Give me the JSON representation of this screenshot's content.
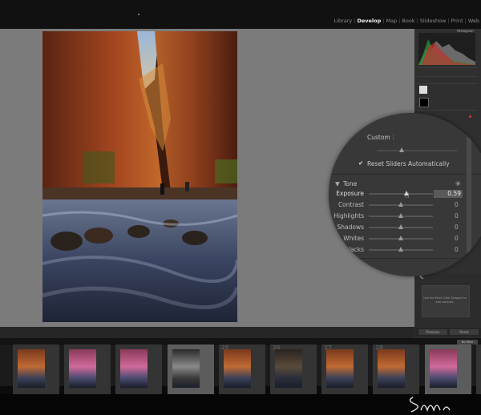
{
  "modules": {
    "items": [
      {
        "label": "Library",
        "active": false
      },
      {
        "label": "Develop",
        "active": true
      },
      {
        "label": "Map",
        "active": false
      },
      {
        "label": "Book",
        "active": false
      },
      {
        "label": "Slideshow",
        "active": false
      },
      {
        "label": "Print",
        "active": false
      },
      {
        "label": "Web",
        "active": false
      }
    ]
  },
  "right_panel": {
    "histogram_label": "Histogram",
    "dropper_hint": "Use the Point Color Dropper to add samples.",
    "previous_label": "Previous",
    "reset_label": "Reset"
  },
  "zoom_panel": {
    "profile_value": "Custom",
    "reset_sliders_label": "Reset Sliders Automatically",
    "tone_header": "Tone",
    "sliders": [
      {
        "label": "Exposure",
        "value": "0.59",
        "level": 0.57
      },
      {
        "label": "Contrast",
        "value": "0",
        "level": 0.5
      },
      {
        "label": "Highlights",
        "value": "0",
        "level": 0.5
      },
      {
        "label": "Shadows",
        "value": "0",
        "level": 0.5
      },
      {
        "label": "Whites",
        "value": "0",
        "level": 0.5
      },
      {
        "label": "Blacks",
        "value": "0",
        "level": 0.5
      }
    ]
  },
  "filmstrip": {
    "filter_label": "No Filter",
    "frames": [
      {
        "num": "",
        "selected": false,
        "style": "warm"
      },
      {
        "num": "",
        "selected": false,
        "style": "pink"
      },
      {
        "num": "",
        "selected": false,
        "style": "pink"
      },
      {
        "num": "",
        "selected": true,
        "style": "bw"
      },
      {
        "num": "25",
        "selected": false,
        "style": "warm"
      },
      {
        "num": "26",
        "selected": false,
        "style": "dark"
      },
      {
        "num": "27",
        "selected": false,
        "style": "warm"
      },
      {
        "num": "28",
        "selected": false,
        "style": "warm"
      },
      {
        "num": "",
        "selected": true,
        "style": "pink"
      },
      {
        "num": "",
        "selected": false,
        "style": "warm"
      }
    ]
  },
  "colors": {
    "workspace_bg": "#7b7b7b",
    "panel_bg": "#2f2f2f",
    "zoom_bg": "#383838",
    "active_module": "#f0f0f0"
  }
}
